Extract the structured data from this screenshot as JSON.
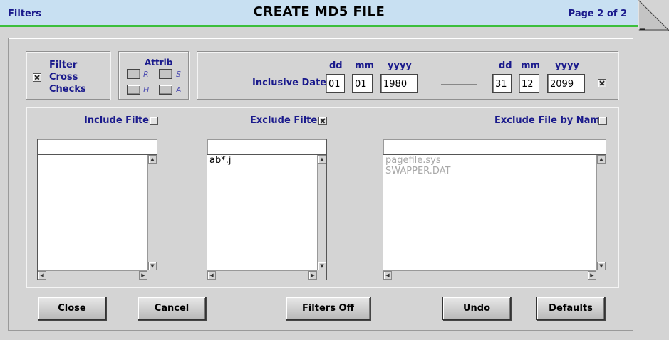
{
  "header": {
    "left_label": "Filters",
    "title": "CREATE MD5 FILE",
    "page_label": "Page 2 of 2",
    "corner_glyph": "_"
  },
  "cross_checks": {
    "line1": "Filter",
    "line2": "Cross",
    "line3": "Checks",
    "checked": true
  },
  "attrib": {
    "label": "Attrib",
    "items": [
      {
        "letter": "R"
      },
      {
        "letter": "S"
      },
      {
        "letter": "H"
      },
      {
        "letter": "A"
      }
    ]
  },
  "dates": {
    "label": "Inclusive Date:",
    "dd_label": "dd",
    "mm_label": "mm",
    "yyyy_label": "yyyy",
    "from": {
      "dd": "01",
      "mm": "01",
      "yyyy": "1980"
    },
    "to": {
      "dd": "31",
      "mm": "12",
      "yyyy": "2099"
    },
    "checked": true
  },
  "include_filter": {
    "label": "Include Filter",
    "checked": false,
    "input_value": "",
    "items": []
  },
  "exclude_filter": {
    "label": "Exclude Filter",
    "checked": true,
    "input_value": "",
    "items": [
      "ab*.j"
    ]
  },
  "exclude_name": {
    "label": "Exclude File by Name",
    "checked": false,
    "input_value": "",
    "items": [
      "pagefile.sys",
      "SWAPPER.DAT"
    ]
  },
  "buttons": {
    "close": {
      "mnemonic": "C",
      "rest": "lose"
    },
    "cancel": {
      "label": "Cancel"
    },
    "filters_off": {
      "mnemonic": "F",
      "rest": "ilters Off"
    },
    "undo": {
      "mnemonic": "U",
      "rest": "ndo"
    },
    "defaults": {
      "mnemonic": "D",
      "rest": "efaults"
    }
  },
  "colors": {
    "title_bg": "#c8e0f2",
    "accent_line": "#3cbf3c",
    "label_text": "#1a1a8c",
    "window_bg": "#d4d4d4"
  }
}
